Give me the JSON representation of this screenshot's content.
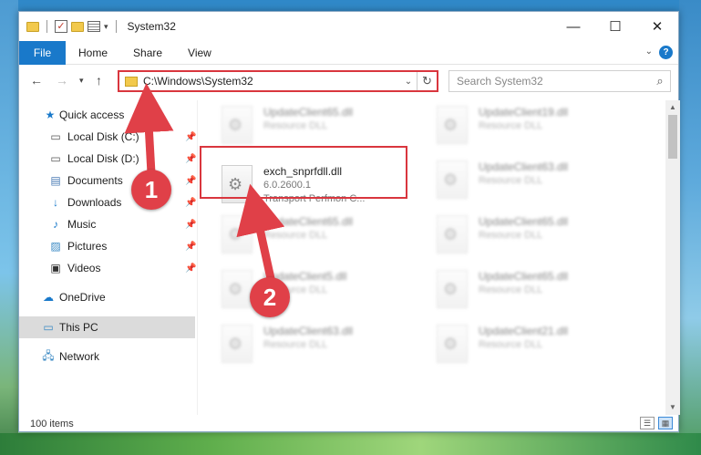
{
  "window": {
    "title": "System32",
    "controls": {
      "minimize": "—",
      "maximize": "☐",
      "close": "✕"
    }
  },
  "ribbon": {
    "tabs": [
      "File",
      "Home",
      "Share",
      "View"
    ],
    "help": "?"
  },
  "address": {
    "path": "C:\\Windows\\System32",
    "search_placeholder": "Search System32"
  },
  "sidebar": {
    "quick_access": "Quick access",
    "items": [
      {
        "label": "Local Disk (C:)",
        "icon": "drive-icon"
      },
      {
        "label": "Local Disk (D:)",
        "icon": "drive-icon"
      },
      {
        "label": "Documents",
        "icon": "documents-icon"
      },
      {
        "label": "Downloads",
        "icon": "download-icon"
      },
      {
        "label": "Music",
        "icon": "music-icon"
      },
      {
        "label": "Pictures",
        "icon": "pictures-icon"
      },
      {
        "label": "Videos",
        "icon": "videos-icon"
      }
    ],
    "onedrive": "OneDrive",
    "this_pc": "This PC",
    "network": "Network"
  },
  "files": {
    "highlighted": {
      "name": "exch_snprfdll.dll",
      "version": "6.0.2600.1",
      "description": "Transport Perfmon C..."
    },
    "background_tiles": [
      {
        "name": "UpdateClient65.dll",
        "type": "Resource DLL"
      },
      {
        "name": "UpdateClient19.dll",
        "type": "Resource DLL"
      },
      {
        "name": "UpdateClient63.dll",
        "type": "Resource DLL"
      },
      {
        "name": "UpdateClient65.dll",
        "type": "Resource DLL"
      },
      {
        "name": "UpdateClient65.dll",
        "type": "Resource DLL"
      },
      {
        "name": "UpdateClient5.dll",
        "type": "Resource DLL"
      },
      {
        "name": "UpdateClient65.dll",
        "type": "Resource DLL"
      },
      {
        "name": "UpdateClient63.dll",
        "type": "Resource DLL"
      },
      {
        "name": "UpdateClient21.dll",
        "type": "Resource DLL"
      }
    ]
  },
  "status": {
    "item_count": "100 items"
  },
  "callouts": {
    "step1": "1",
    "step2": "2"
  },
  "colors": {
    "accent": "#1979ca",
    "highlight": "#d9363e",
    "callout": "#e04048"
  }
}
